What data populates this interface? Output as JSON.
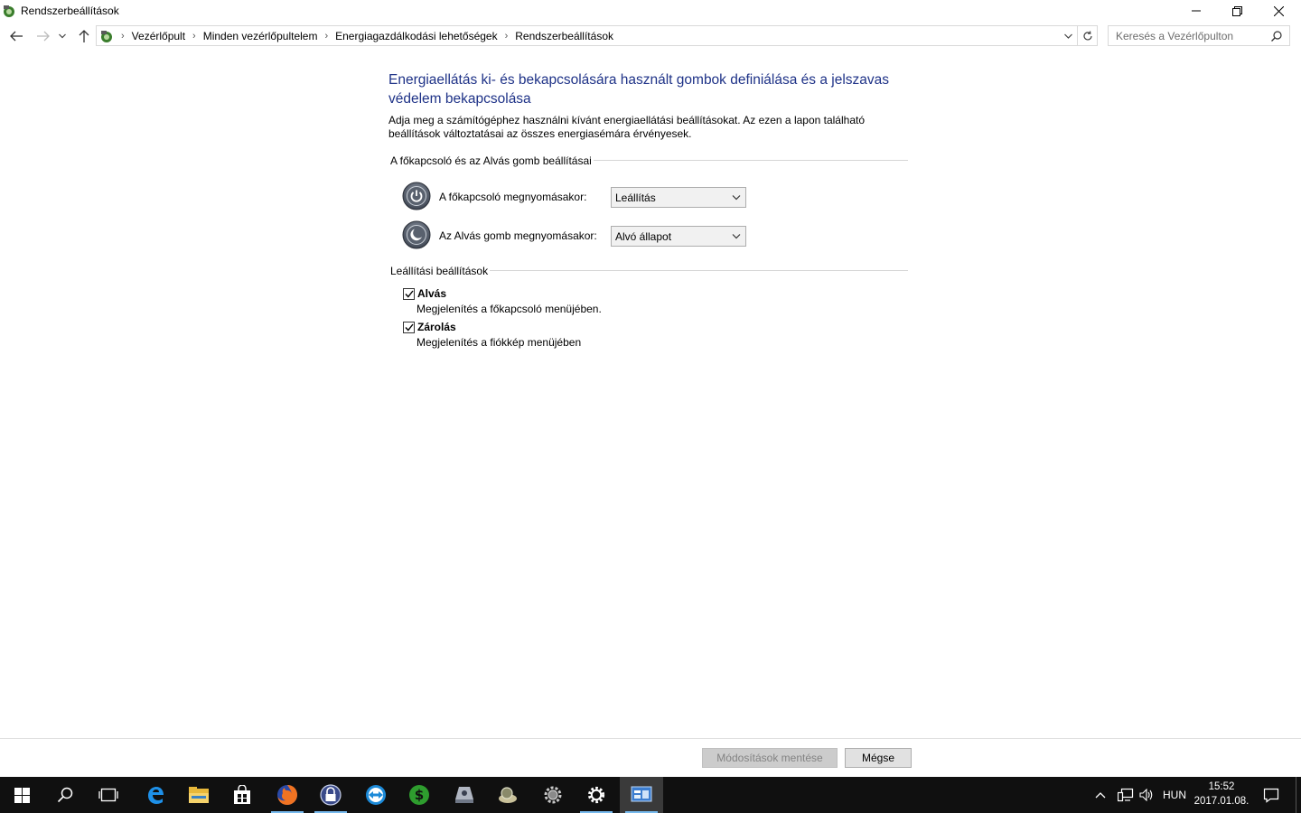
{
  "window": {
    "title": "Rendszerbeállítások"
  },
  "breadcrumb": {
    "items": [
      "Vezérlőpult",
      "Minden vezérlőpultelem",
      "Energiagazdálkodási lehetőségek",
      "Rendszerbeállítások"
    ]
  },
  "search": {
    "placeholder": "Keresés a Vezérlőpulton"
  },
  "main": {
    "heading": "Energiaellátás ki- és bekapcsolására használt gombok definiálása és a jelszavas védelem bekapcsolása",
    "description": "Adja meg a számítógéphez használni kívánt energiaellátási beállításokat. Az ezen a lapon található beállítások változtatásai az összes energiasémára érvényesek.",
    "buttons_group": {
      "title": "A főkapcsoló és az Alvás gomb beállításai",
      "power_label": "A főkapcsoló megnyomásakor:",
      "power_value": "Leállítás",
      "sleep_label": "Az Alvás gomb megnyomásakor:",
      "sleep_value": "Alvó állapot"
    },
    "shutdown_group": {
      "title": "Leállítási beállítások",
      "items": [
        {
          "label": "Alvás",
          "sub": "Megjelenítés a főkapcsoló menüjében.",
          "checked": true
        },
        {
          "label": "Zárolás",
          "sub": "Megjelenítés a fiókkép menüjében",
          "checked": true
        }
      ]
    }
  },
  "footer": {
    "save_label": "Módosítások mentése",
    "cancel_label": "Mégse"
  },
  "taskbar": {
    "language": "HUN",
    "time": "15:52",
    "date": "2017.01.08."
  },
  "colors": {
    "heading": "#1e3287",
    "taskbar": "#101010",
    "accent": "#76b9ed"
  }
}
